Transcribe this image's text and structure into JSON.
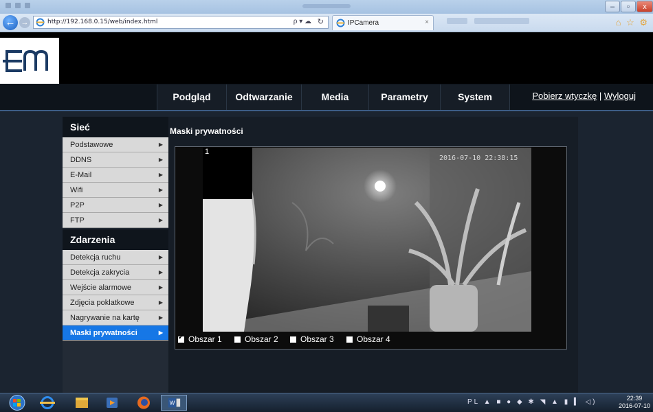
{
  "browser": {
    "url": "http://192.168.0.15/web/index.html",
    "search_glyph": "ρ ▾ ☁",
    "tab_title": "IPCamera",
    "tab_close": "×",
    "window_controls": {
      "minimize": "–",
      "maximize": "▫",
      "close": "x"
    },
    "toolbar_icons": "⌂ ☆ ⚙"
  },
  "logo": {
    "text": "EM"
  },
  "nav": {
    "items": [
      "Podgląd",
      "Odtwarzanie",
      "Media",
      "Parametry",
      "System"
    ],
    "links": [
      "Pobierz wtyczkę",
      "Wyloguj"
    ],
    "separator": "|"
  },
  "sidebar": {
    "sections": [
      {
        "title": "Sieć",
        "items": [
          "Podstawowe",
          "DDNS",
          "E-Mail",
          "Wifi",
          "P2P",
          "FTP"
        ]
      },
      {
        "title": "Zdarzenia",
        "items": [
          "Detekcja ruchu",
          "Detekcja zakrycia",
          "Wejście alarmowe",
          "Zdjęcia poklatkowe",
          "Nagrywanie na kartę",
          "Maski prywatności"
        ]
      }
    ],
    "active_item": "Maski prywatności",
    "arrow": "▶"
  },
  "content": {
    "title": "Maski prywatności",
    "camera": {
      "timestamp": "2016-07-10 22:38:15",
      "mask_label": "1"
    },
    "areas": [
      {
        "label": "Obszar 1",
        "checked": true
      },
      {
        "label": "Obszar 2",
        "checked": false
      },
      {
        "label": "Obszar 3",
        "checked": false
      },
      {
        "label": "Obszar 4",
        "checked": false
      }
    ]
  },
  "taskbar": {
    "apps": [
      "start-orb-icon",
      "internet-explorer-icon",
      "file-explorer-icon",
      "media-player-icon",
      "firefox-icon",
      "word-icon"
    ],
    "language": "PL",
    "clock_time": "22:39",
    "clock_date": "2016-07-10"
  },
  "colors": {
    "accent": "#1677e6",
    "nav_border": "#3d5d86",
    "page_bg": "#1b2430"
  }
}
